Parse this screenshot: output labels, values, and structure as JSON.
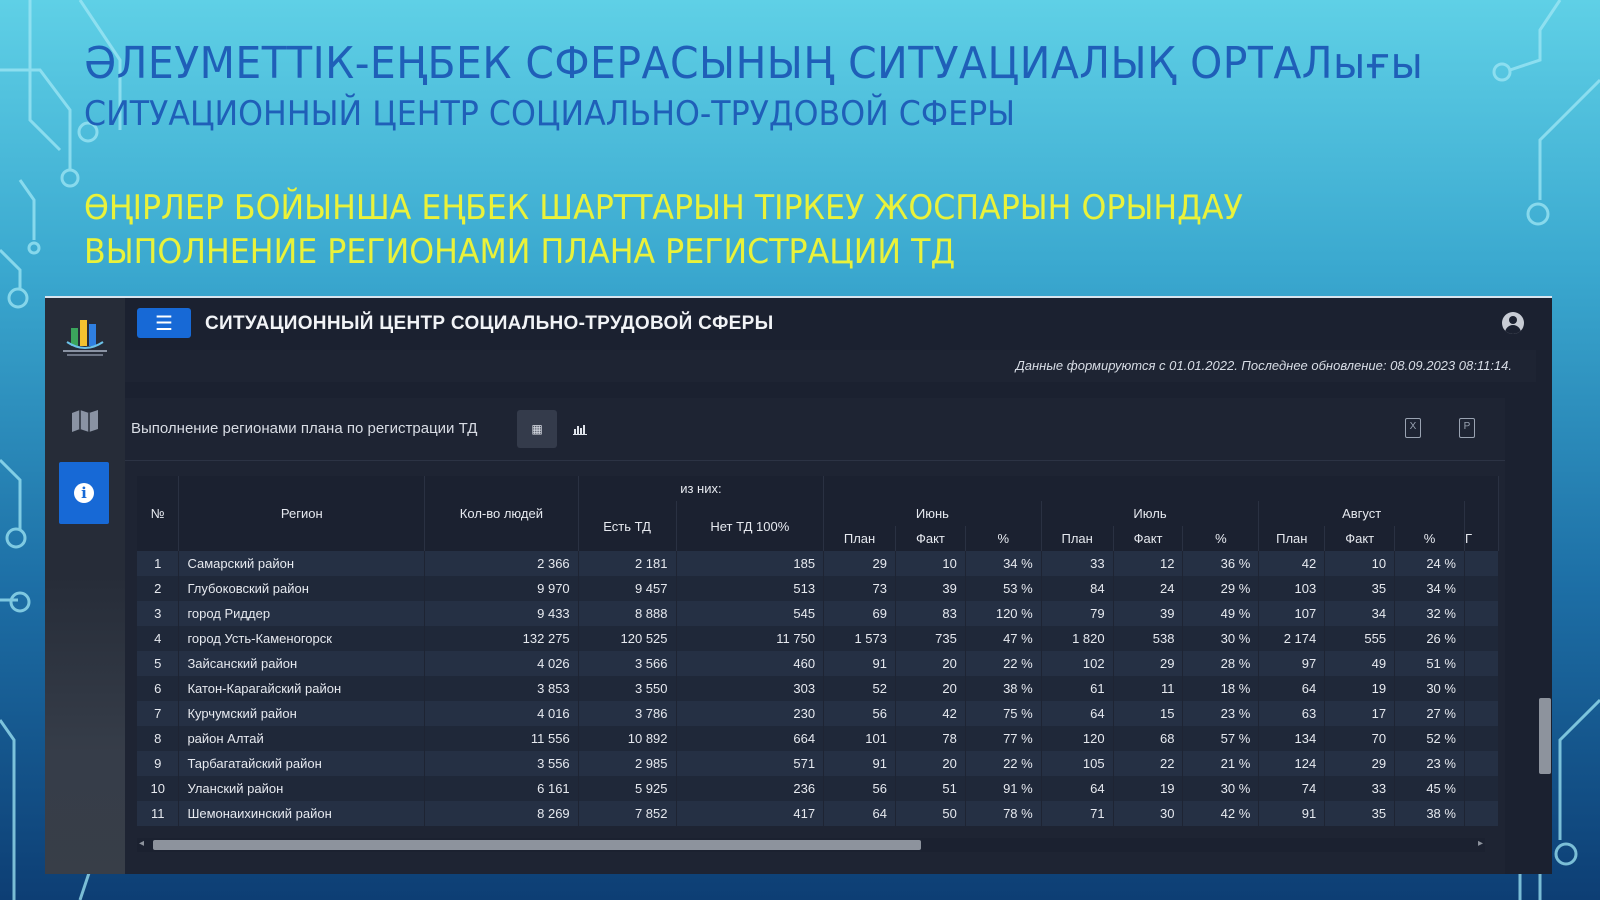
{
  "slide": {
    "title_kz": "ӘЛЕУМЕТТІК-ЕҢБЕК СФЕРАСЫНЫҢ СИТУАЦИАЛЫҚ ОРТАЛығы",
    "title_ru": "СИТУАЦИОННЫЙ ЦЕНТР СОЦИАЛЬНО-ТРУДОВОЙ СФЕРЫ",
    "subtitle_kz": "ӨҢІРЛЕР БОЙЫНША ЕҢБЕК ШАРТТАРЫН ТІРКЕУ ЖОСПАРЫН ОРЫНДАУ",
    "subtitle_ru": "ВЫПОЛНЕНИЕ РЕГИОНАМИ ПЛАНА РЕГИСТРАЦИИ ТД"
  },
  "app": {
    "title": "СИТУАЦИОННЫЙ ЦЕНТР СОЦИАЛЬНО-ТРУДОВОЙ СФЕРЫ",
    "menu_icon": "☰",
    "update_info": "Данные формируются с 01.01.2022. Последнее обновление: 08.09.2023 08:11:14.",
    "accent_color": "#1769d6",
    "sidebar": {
      "icons": [
        "logo",
        "map-icon",
        "info-icon"
      ]
    }
  },
  "panel": {
    "title": "Выполнение регионами плана по регистрации ТД",
    "table_view_icon": "▦",
    "chart_view_icon": "📊",
    "export_xls_icon": "X",
    "export_pdf_icon": "P"
  },
  "table": {
    "headers": {
      "num": "№",
      "region": "Регион",
      "people": "Кол-во людей",
      "of_them": "из них:",
      "has_td": "Есть ТД",
      "no_td": "Нет ТД 100%",
      "june": "Июнь",
      "july": "Июль",
      "august": "Август",
      "plan": "План",
      "fact": "Факт",
      "pct": "%",
      "next_cut": "Г"
    },
    "rows": [
      {
        "n": "1",
        "region": "Самарский район",
        "people": "2 366",
        "has": "2 181",
        "no": "185",
        "jun_p": "29",
        "jun_f": "10",
        "jun_pct": "34 %",
        "jul_p": "33",
        "jul_f": "12",
        "jul_pct": "36 %",
        "aug_p": "42",
        "aug_f": "10",
        "aug_pct": "24 %"
      },
      {
        "n": "2",
        "region": "Глубоковский район",
        "people": "9 970",
        "has": "9 457",
        "no": "513",
        "jun_p": "73",
        "jun_f": "39",
        "jun_pct": "53 %",
        "jul_p": "84",
        "jul_f": "24",
        "jul_pct": "29 %",
        "aug_p": "103",
        "aug_f": "35",
        "aug_pct": "34 %"
      },
      {
        "n": "3",
        "region": "город Риддер",
        "people": "9 433",
        "has": "8 888",
        "no": "545",
        "jun_p": "69",
        "jun_f": "83",
        "jun_pct": "120 %",
        "jul_p": "79",
        "jul_f": "39",
        "jul_pct": "49 %",
        "aug_p": "107",
        "aug_f": "34",
        "aug_pct": "32 %"
      },
      {
        "n": "4",
        "region": "город Усть-Каменогорск",
        "people": "132 275",
        "has": "120 525",
        "no": "11 750",
        "jun_p": "1 573",
        "jun_f": "735",
        "jun_pct": "47 %",
        "jul_p": "1 820",
        "jul_f": "538",
        "jul_pct": "30 %",
        "aug_p": "2 174",
        "aug_f": "555",
        "aug_pct": "26 %"
      },
      {
        "n": "5",
        "region": "Зайсанский район",
        "people": "4 026",
        "has": "3 566",
        "no": "460",
        "jun_p": "91",
        "jun_f": "20",
        "jun_pct": "22 %",
        "jul_p": "102",
        "jul_f": "29",
        "jul_pct": "28 %",
        "aug_p": "97",
        "aug_f": "49",
        "aug_pct": "51 %"
      },
      {
        "n": "6",
        "region": "Катон-Карагайский район",
        "people": "3 853",
        "has": "3 550",
        "no": "303",
        "jun_p": "52",
        "jun_f": "20",
        "jun_pct": "38 %",
        "jul_p": "61",
        "jul_f": "11",
        "jul_pct": "18 %",
        "aug_p": "64",
        "aug_f": "19",
        "aug_pct": "30 %"
      },
      {
        "n": "7",
        "region": "Курчумский район",
        "people": "4 016",
        "has": "3 786",
        "no": "230",
        "jun_p": "56",
        "jun_f": "42",
        "jun_pct": "75 %",
        "jul_p": "64",
        "jul_f": "15",
        "jul_pct": "23 %",
        "aug_p": "63",
        "aug_f": "17",
        "aug_pct": "27 %"
      },
      {
        "n": "8",
        "region": "район Алтай",
        "people": "11 556",
        "has": "10 892",
        "no": "664",
        "jun_p": "101",
        "jun_f": "78",
        "jun_pct": "77 %",
        "jul_p": "120",
        "jul_f": "68",
        "jul_pct": "57 %",
        "aug_p": "134",
        "aug_f": "70",
        "aug_pct": "52 %"
      },
      {
        "n": "9",
        "region": "Тарбагатайский район",
        "people": "3 556",
        "has": "2 985",
        "no": "571",
        "jun_p": "91",
        "jun_f": "20",
        "jun_pct": "22 %",
        "jul_p": "105",
        "jul_f": "22",
        "jul_pct": "21 %",
        "aug_p": "124",
        "aug_f": "29",
        "aug_pct": "23 %"
      },
      {
        "n": "10",
        "region": "Уланский район",
        "people": "6 161",
        "has": "5 925",
        "no": "236",
        "jun_p": "56",
        "jun_f": "51",
        "jun_pct": "91 %",
        "jul_p": "64",
        "jul_f": "19",
        "jul_pct": "30 %",
        "aug_p": "74",
        "aug_f": "33",
        "aug_pct": "45 %"
      },
      {
        "n": "11",
        "region": "Шемонаихинский район",
        "people": "8 269",
        "has": "7 852",
        "no": "417",
        "jun_p": "64",
        "jun_f": "50",
        "jun_pct": "78 %",
        "jul_p": "71",
        "jul_f": "30",
        "jul_pct": "42 %",
        "aug_p": "91",
        "aug_f": "35",
        "aug_pct": "38 %"
      }
    ]
  }
}
